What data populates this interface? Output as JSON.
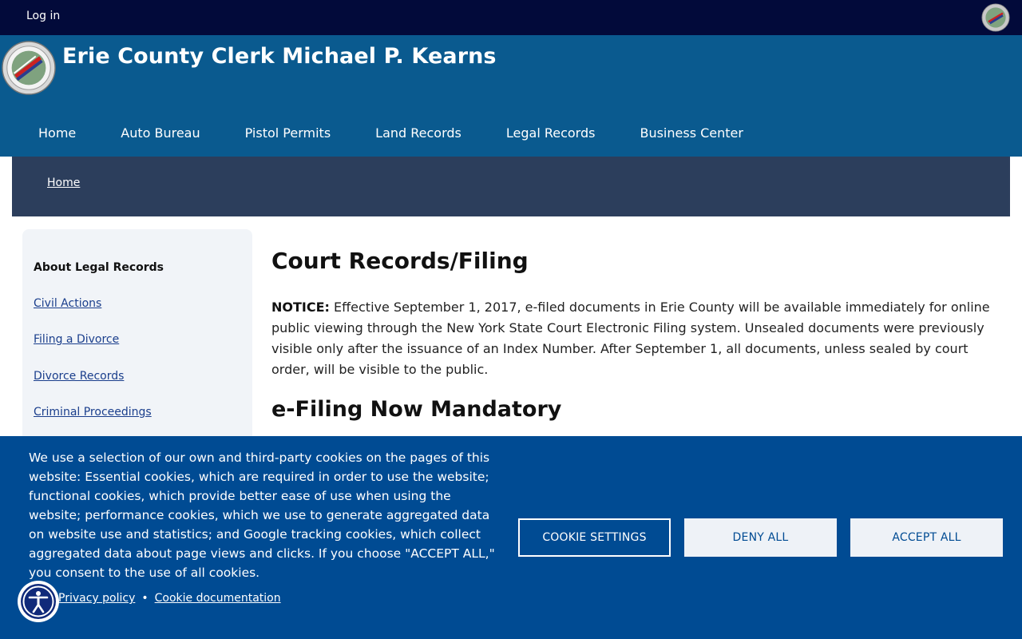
{
  "topbar": {
    "login": "Log in"
  },
  "header": {
    "title": "Erie County Clerk Michael P. Kearns"
  },
  "nav": [
    {
      "label": "Home"
    },
    {
      "label": "Auto Bureau"
    },
    {
      "label": "Pistol Permits"
    },
    {
      "label": "Land Records"
    },
    {
      "label": "Legal Records"
    },
    {
      "label": "Business Center"
    }
  ],
  "breadcrumb": {
    "home": "Home"
  },
  "sidebar": {
    "heading": "About Legal Records",
    "links": [
      {
        "label": "Civil Actions"
      },
      {
        "label": "Filing a Divorce"
      },
      {
        "label": "Divorce Records"
      },
      {
        "label": "Criminal Proceedings"
      }
    ]
  },
  "main": {
    "title": "Court Records/Filing",
    "notice_label": "NOTICE:",
    "notice_text": " Effective September 1, 2017, e-filed documents in Erie County will be available immediately for online public viewing through the New York State Court Electronic Filing system.  Unsealed documents were previously visible only after the issuance of an Index Number.   After September 1, all documents, unless sealed by court order, will be visible to the public.",
    "subtitle": "e-Filing Now Mandatory"
  },
  "cookie": {
    "text": "We use a selection of our own and third-party cookies on the pages of this website: Essential cookies, which are required in order to use the website; functional cookies, which provide better ease of use when using the website; performance cookies, which we use to generate aggregated data on website use and statistics; and Google tracking cookies, which collect aggregated data about page views and clicks. If you choose \"ACCEPT ALL,\" you consent to the use of all cookies.",
    "privacy": "Privacy policy",
    "separator": "•",
    "documentation": "Cookie documentation",
    "settings": "COOKIE SETTINGS",
    "deny": "DENY ALL",
    "accept": "ACCEPT ALL"
  },
  "icons": {
    "seal": "county-seal-icon",
    "accessibility": "accessibility-icon"
  },
  "colors": {
    "topbar": "#020a3a",
    "header": "#0a5a8f",
    "breadcrumb_bar": "#2c3e5c",
    "cookie_banner": "#004b93",
    "link": "#1a3e8c"
  }
}
